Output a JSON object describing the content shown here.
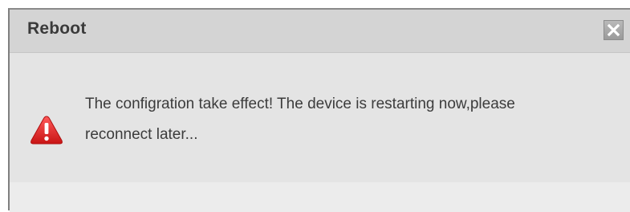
{
  "dialog": {
    "title": "Reboot",
    "close_icon": "close-icon",
    "warning_icon": "warning-triangle-icon",
    "message": "The configration take effect! The device is restarting now,please reconnect later...",
    "colors": {
      "titlebar": "#d4d4d4",
      "body": "#e4e4e4",
      "footer": "#ececec",
      "warning": "#e02020",
      "text": "#3c3c3c"
    }
  }
}
